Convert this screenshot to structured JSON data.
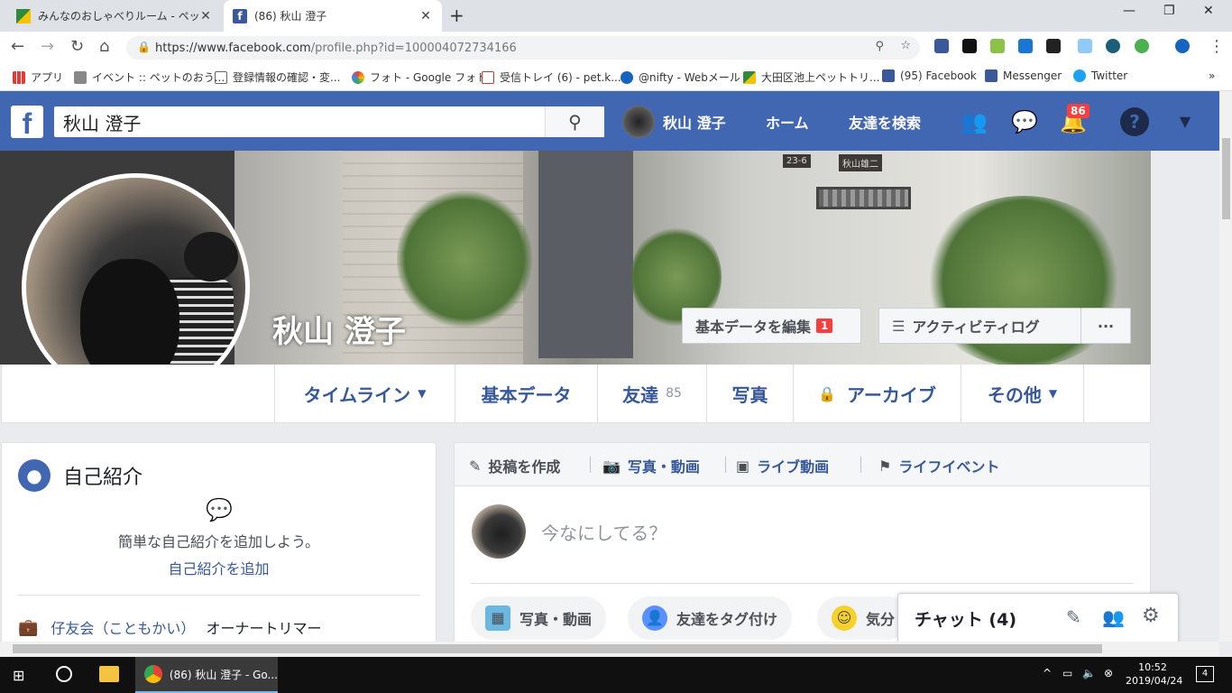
{
  "browser": {
    "tabs": [
      {
        "title": "みんなのおしゃべりルーム - ペットのトリ",
        "active": false
      },
      {
        "title": "(86) 秋山 澄子",
        "active": true
      }
    ],
    "url_prefix": "https://www.facebook.com",
    "url_rest": "/profile.php?id=100004072734166",
    "bookmarks": [
      "アプリ",
      "イベント :: ペットのおう...",
      "登録情報の確認・変...",
      "フォト - Google フォト",
      "受信トレイ (6) - pet.k...",
      "@nifty - Webメール",
      "大田区池上ペットトリ...",
      "(95) Facebook",
      "Messenger",
      "Twitter"
    ]
  },
  "fbbar": {
    "logo": "f",
    "search_value": "秋山 澄子",
    "user_name": "秋山 澄子",
    "home": "ホーム",
    "find_friends": "友達を検索",
    "notif_count": "86"
  },
  "profile": {
    "name": "秋山 澄子",
    "edit_button": "基本データを編集",
    "edit_badge": "1",
    "activity_log": "アクティビティログ",
    "more": "···",
    "cover_sign1": "23-6",
    "cover_sign2": "秋山雄二"
  },
  "timeline_tabs": [
    {
      "label": "タイムライン",
      "caret": true
    },
    {
      "label": "基本データ"
    },
    {
      "label": "友達",
      "count": "85"
    },
    {
      "label": "写真"
    },
    {
      "label": "アーカイブ",
      "lock": true
    },
    {
      "label": "その他",
      "caret": true
    }
  ],
  "intro": {
    "title": "自己紹介",
    "prompt": "簡単な自己紹介を追加しよう。",
    "add_link": "自己紹介を追加",
    "work_org": "仔友会（こともかい）",
    "work_role": "オーナートリマー"
  },
  "composer": {
    "tabs": [
      "投稿を作成",
      "写真・動画",
      "ライブ動画",
      "ライフイベント"
    ],
    "placeholder": "今なにしてる？",
    "actions": [
      "写真・動画",
      "友達をタグ付け",
      "気分"
    ]
  },
  "chat": {
    "label": "チャット (4)"
  },
  "taskbar": {
    "app_title": "(86) 秋山 澄子 - Go...",
    "time": "10:52",
    "date": "2019/04/24",
    "notif": "4"
  }
}
